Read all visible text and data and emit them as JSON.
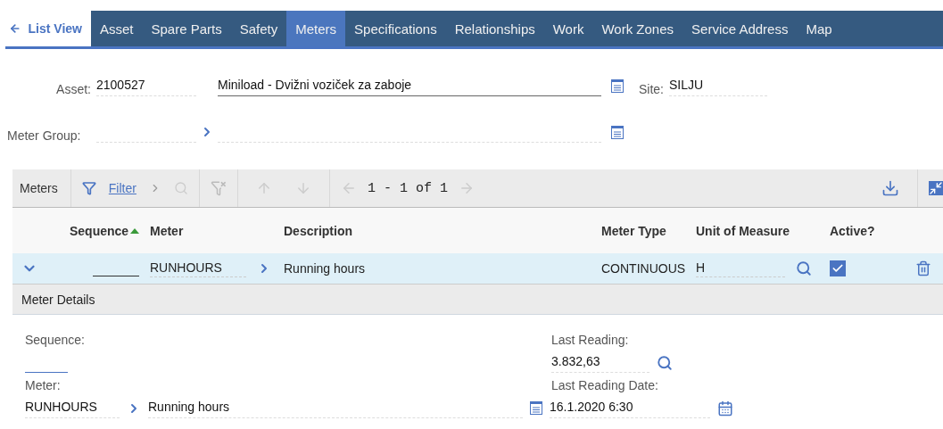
{
  "nav": {
    "back_label": "List View",
    "tabs": [
      {
        "label": "Asset",
        "selected": false
      },
      {
        "label": "Spare Parts",
        "selected": false
      },
      {
        "label": "Safety",
        "selected": false
      },
      {
        "label": "Meters",
        "selected": true
      },
      {
        "label": "Specifications",
        "selected": false
      },
      {
        "label": "Relationships",
        "selected": false
      },
      {
        "label": "Work",
        "selected": false
      },
      {
        "label": "Work Zones",
        "selected": false
      },
      {
        "label": "Service Address",
        "selected": false
      },
      {
        "label": "Map",
        "selected": false
      }
    ]
  },
  "header": {
    "asset": {
      "label": "Asset:",
      "value": "2100527"
    },
    "description": "Miniload - Dvižni voziček za zaboje",
    "site": {
      "label": "Site:",
      "value": "SILJU"
    },
    "meter_group": {
      "label": "Meter Group:"
    }
  },
  "table": {
    "title": "Meters",
    "filter": "Filter",
    "pagination": "1 - 1 of 1",
    "columns": [
      {
        "label": "Sequence",
        "sorted": true
      },
      {
        "label": "Meter",
        "sorted": false
      },
      {
        "label": "Description",
        "sorted": false
      },
      {
        "label": "Meter Type",
        "sorted": false
      },
      {
        "label": "Unit of Measure",
        "sorted": false
      },
      {
        "label": "Active?",
        "sorted": false
      }
    ],
    "rows": [
      {
        "meter": "RUNHOURS",
        "description": "Running hours",
        "meter_type": "CONTINUOUS",
        "unit": "H",
        "active": true,
        "expanded": true
      }
    ]
  },
  "details": {
    "title": "Meter Details",
    "sequence_label": "Sequence:",
    "last_reading": {
      "label": "Last Reading:",
      "value": "3.832,63"
    },
    "meter": {
      "label": "Meter:",
      "value": "RUNHOURS",
      "description": "Running hours"
    },
    "last_reading_date": {
      "label": "Last Reading Date:",
      "value": "16.1.2020 6:30"
    }
  }
}
